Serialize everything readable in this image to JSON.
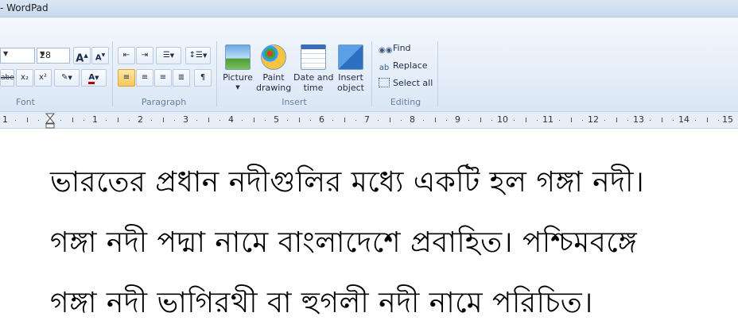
{
  "window": {
    "title": "- WordPad"
  },
  "ribbon": {
    "font": {
      "label": "Font",
      "font_size": "28",
      "grow_label": "A",
      "shrink_label": "A",
      "strike_label": "abe",
      "subscript_label": "x₂",
      "superscript_label": "x²",
      "color_label": "A"
    },
    "paragraph": {
      "label": "Paragraph"
    },
    "insert": {
      "label": "Insert",
      "picture": "Picture",
      "paint_line1": "Paint",
      "paint_line2": "drawing",
      "date_line1": "Date and",
      "date_line2": "time",
      "object_line1": "Insert",
      "object_line2": "object"
    },
    "editing": {
      "label": "Editing",
      "find": "Find",
      "replace": "Replace",
      "select_all": "Select all"
    }
  },
  "ruler": {
    "numbers": [
      "1",
      "1",
      "2",
      "3",
      "4",
      "5",
      "6",
      "7",
      "8",
      "9",
      "10",
      "11",
      "12",
      "13",
      "14",
      "15"
    ]
  },
  "document": {
    "lines": [
      "ভারতের প্রধান নদীগুলির মধ্যে একটি হল গঙ্গা নদী।",
      "গঙ্গা নদী পদ্মা নামে বাংলাদেশে প্রবাহিত। পশ্চিমবঙ্গে",
      "গঙ্গা নদী ভাগিরথী বা হুগলী নদী নামে পরিচিত।"
    ]
  },
  "colors": {
    "accent": "#1e395b",
    "selected": "#f8c75b",
    "font_color": "#c00000"
  }
}
